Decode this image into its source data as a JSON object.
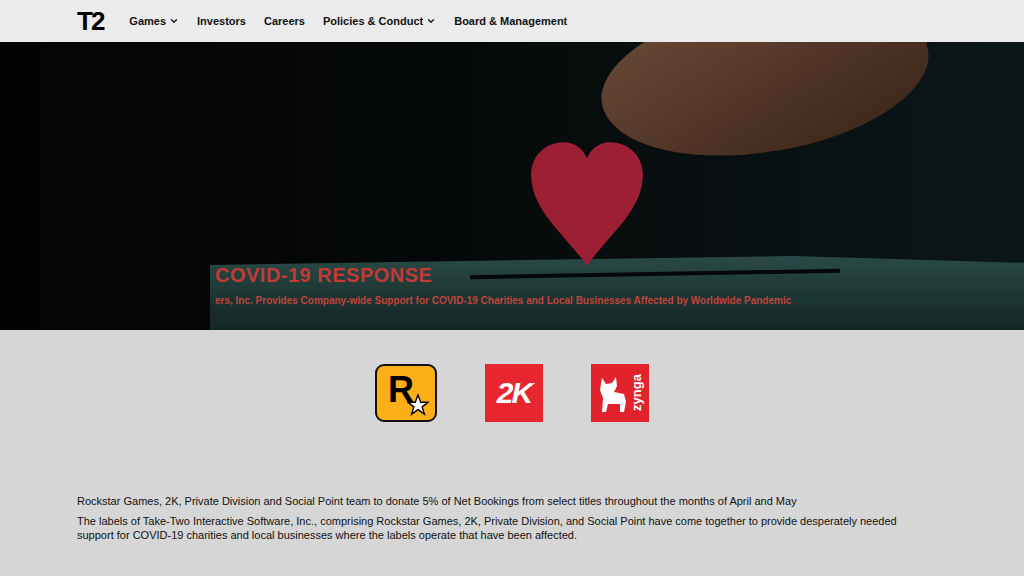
{
  "nav": {
    "logo": "T2",
    "items": [
      {
        "label": "Games",
        "dropdown": true
      },
      {
        "label": "Investors",
        "dropdown": false
      },
      {
        "label": "Careers",
        "dropdown": false
      },
      {
        "label": "Policies & Conduct",
        "dropdown": true
      },
      {
        "label": "Board & Management",
        "dropdown": false
      }
    ]
  },
  "hero": {
    "title": "COVID-19 RESPONSE",
    "subtitle": "ers, Inc. Provides Company-wide Support for COVID-19 Charities and Local Businesses Affected by Worldwide Pandemic"
  },
  "logos": [
    {
      "name": "rockstar",
      "text": "R",
      "color": "#fcaf17"
    },
    {
      "name": "2k",
      "text": "2K",
      "color": "#e8262f"
    },
    {
      "name": "zynga",
      "text": "zynga",
      "color": "#e3232c"
    }
  ],
  "content": {
    "intro": "Rockstar Games, 2K, Private Division and Social Point team to donate 5% of Net Bookings from select titles throughout the months of April and May",
    "body": "The labels of Take-Two Interactive Software, Inc., comprising Rockstar Games, 2K, Private Division, and Social Point have come together to provide desperately needed support for COVID-19 charities and local businesses where the labels operate that have been affected."
  }
}
